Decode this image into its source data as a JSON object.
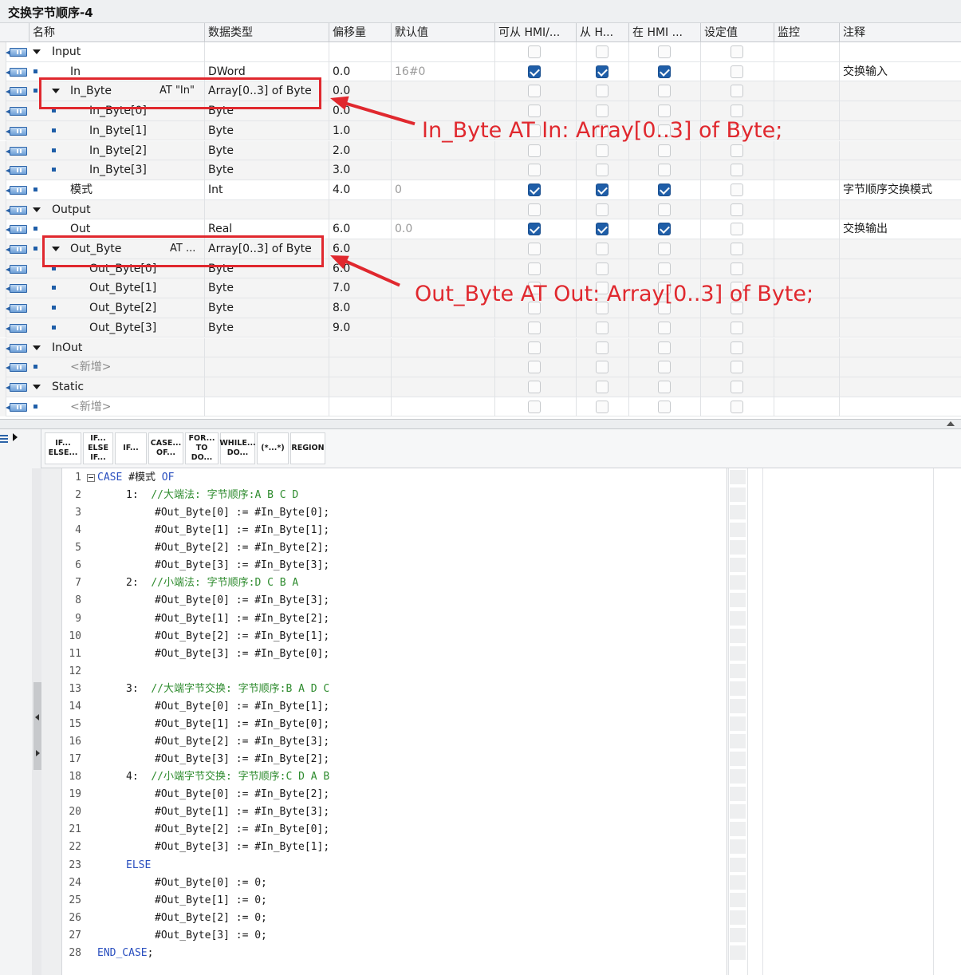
{
  "window": {
    "title": "交换字节顺序-4"
  },
  "columns": [
    "名称",
    "数据类型",
    "偏移量",
    "默认值",
    "可从 HMI/...",
    "从 H...",
    "在 HMI ...",
    "设定值",
    "监控",
    "注释"
  ],
  "rows": [
    {
      "level": 0,
      "kind": "section",
      "name": "Input",
      "expand": true,
      "type": "",
      "offset": "",
      "default": "",
      "checks": [
        false,
        false,
        false,
        false
      ],
      "comment": "",
      "bg": "white"
    },
    {
      "level": 1,
      "kind": "var",
      "name": "In",
      "type": "DWord",
      "offset": "0.0",
      "default": "16#0",
      "checks": [
        true,
        true,
        true,
        false
      ],
      "comment": "交换输入",
      "bg": "white"
    },
    {
      "level": 1,
      "kind": "at",
      "name": "In_Byte",
      "expand": true,
      "at_text": "AT \"In\"",
      "type": "Array[0..3] of Byte",
      "offset": "0.0",
      "default": "",
      "checks": [
        false,
        false,
        false,
        false
      ],
      "comment": "",
      "bg": "grey"
    },
    {
      "level": 2,
      "kind": "elem",
      "name": "In_Byte[0]",
      "type": "Byte",
      "offset": "0.0",
      "default": "",
      "checks": [
        false,
        false,
        false,
        false
      ],
      "comment": "",
      "bg": "grey"
    },
    {
      "level": 2,
      "kind": "elem",
      "name": "In_Byte[1]",
      "type": "Byte",
      "offset": "1.0",
      "default": "",
      "checks": [
        false,
        false,
        false,
        false
      ],
      "comment": "",
      "bg": "grey"
    },
    {
      "level": 2,
      "kind": "elem",
      "name": "In_Byte[2]",
      "type": "Byte",
      "offset": "2.0",
      "default": "",
      "checks": [
        false,
        false,
        false,
        false
      ],
      "comment": "",
      "bg": "grey"
    },
    {
      "level": 2,
      "kind": "elem",
      "name": "In_Byte[3]",
      "type": "Byte",
      "offset": "3.0",
      "default": "",
      "checks": [
        false,
        false,
        false,
        false
      ],
      "comment": "",
      "bg": "grey"
    },
    {
      "level": 1,
      "kind": "var",
      "name": "模式",
      "type": "Int",
      "offset": "4.0",
      "default": "0",
      "checks": [
        true,
        true,
        true,
        false
      ],
      "comment": "字节顺序交换模式",
      "bg": "white"
    },
    {
      "level": 0,
      "kind": "section",
      "name": "Output",
      "expand": true,
      "type": "",
      "offset": "",
      "default": "",
      "checks": [
        false,
        false,
        false,
        false
      ],
      "comment": "",
      "bg": "grey"
    },
    {
      "level": 1,
      "kind": "var",
      "name": "Out",
      "type": "Real",
      "offset": "6.0",
      "default": "0.0",
      "checks": [
        true,
        true,
        true,
        false
      ],
      "comment": "交换输出",
      "bg": "white"
    },
    {
      "level": 1,
      "kind": "at",
      "name": "Out_Byte",
      "expand": true,
      "at_text": "AT ...",
      "type": "Array[0..3] of Byte",
      "offset": "6.0",
      "default": "",
      "checks": [
        false,
        false,
        false,
        false
      ],
      "comment": "",
      "bg": "grey"
    },
    {
      "level": 2,
      "kind": "elem",
      "name": "Out_Byte[0]",
      "type": "Byte",
      "offset": "6.0",
      "default": "",
      "checks": [
        false,
        false,
        false,
        false
      ],
      "comment": "",
      "bg": "grey"
    },
    {
      "level": 2,
      "kind": "elem",
      "name": "Out_Byte[1]",
      "type": "Byte",
      "offset": "7.0",
      "default": "",
      "checks": [
        false,
        false,
        false,
        false
      ],
      "comment": "",
      "bg": "grey"
    },
    {
      "level": 2,
      "kind": "elem",
      "name": "Out_Byte[2]",
      "type": "Byte",
      "offset": "8.0",
      "default": "",
      "checks": [
        false,
        false,
        false,
        false
      ],
      "comment": "",
      "bg": "grey"
    },
    {
      "level": 2,
      "kind": "elem",
      "name": "Out_Byte[3]",
      "type": "Byte",
      "offset": "9.0",
      "default": "",
      "checks": [
        false,
        false,
        false,
        false
      ],
      "comment": "",
      "bg": "grey"
    },
    {
      "level": 0,
      "kind": "section",
      "name": "InOut",
      "expand": true,
      "type": "",
      "offset": "",
      "default": "",
      "checks": [
        false,
        false,
        false,
        false
      ],
      "comment": "",
      "bg": "grey"
    },
    {
      "level": 1,
      "kind": "new",
      "name": "<新增>",
      "type": "",
      "offset": "",
      "default": "",
      "checks": [
        false,
        false,
        false,
        false
      ],
      "comment": "",
      "bg": "grey"
    },
    {
      "level": 0,
      "kind": "section",
      "name": "Static",
      "expand": true,
      "type": "",
      "offset": "",
      "default": "",
      "checks": [
        false,
        false,
        false,
        false
      ],
      "comment": "",
      "bg": "grey"
    },
    {
      "level": 1,
      "kind": "new",
      "name": "<新增>",
      "type": "",
      "offset": "",
      "default": "",
      "checks": [
        false,
        false,
        false,
        false
      ],
      "comment": "",
      "bg": "white"
    }
  ],
  "annotations": {
    "in_label": "In_Byte AT In: Array[0..3] of Byte;",
    "out_label": "Out_Byte AT Out: Array[0..3] of Byte;"
  },
  "toolbar": [
    {
      "line1": "IF...",
      "line2": "ELSE...",
      "line3": ""
    },
    {
      "line1": "IF...",
      "line2": "ELSE",
      "line3": "IF..."
    },
    {
      "line1": "IF...",
      "line2": "",
      "line3": ""
    },
    {
      "line1": "CASE...",
      "line2": "OF...",
      "line3": ""
    },
    {
      "line1": "FOR...",
      "line2": "TO DO...",
      "line3": ""
    },
    {
      "line1": "WHILE...",
      "line2": "DO...",
      "line3": ""
    },
    {
      "line1": "(*...*)",
      "line2": "",
      "line3": ""
    },
    {
      "line1": "REGION",
      "line2": "",
      "line3": ""
    }
  ],
  "code_lines": [
    {
      "n": "1",
      "indent": 0,
      "parts": [
        [
          "kw",
          "CASE"
        ],
        [
          "t",
          " #模式 "
        ],
        [
          "kw",
          "OF"
        ]
      ],
      "fold": true
    },
    {
      "n": "2",
      "indent": 1,
      "parts": [
        [
          "t",
          "1:  "
        ],
        [
          "cm",
          "//大端法: 字节顺序:A B C D"
        ]
      ]
    },
    {
      "n": "3",
      "indent": 2,
      "parts": [
        [
          "t",
          "#Out_Byte[0] := #In_Byte[0];"
        ]
      ]
    },
    {
      "n": "4",
      "indent": 2,
      "parts": [
        [
          "t",
          "#Out_Byte[1] := #In_Byte[1];"
        ]
      ]
    },
    {
      "n": "5",
      "indent": 2,
      "parts": [
        [
          "t",
          "#Out_Byte[2] := #In_Byte[2];"
        ]
      ]
    },
    {
      "n": "6",
      "indent": 2,
      "parts": [
        [
          "t",
          "#Out_Byte[3] := #In_Byte[3];"
        ]
      ]
    },
    {
      "n": "7",
      "indent": 1,
      "parts": [
        [
          "t",
          "2:  "
        ],
        [
          "cm",
          "//小端法: 字节顺序:D C B A"
        ]
      ]
    },
    {
      "n": "8",
      "indent": 2,
      "parts": [
        [
          "t",
          "#Out_Byte[0] := #In_Byte[3];"
        ]
      ]
    },
    {
      "n": "9",
      "indent": 2,
      "parts": [
        [
          "t",
          "#Out_Byte[1] := #In_Byte[2];"
        ]
      ]
    },
    {
      "n": "10",
      "indent": 2,
      "parts": [
        [
          "t",
          "#Out_Byte[2] := #In_Byte[1];"
        ]
      ]
    },
    {
      "n": "11",
      "indent": 2,
      "parts": [
        [
          "t",
          "#Out_Byte[3] := #In_Byte[0];"
        ]
      ]
    },
    {
      "n": "12",
      "indent": 0,
      "parts": []
    },
    {
      "n": "13",
      "indent": 1,
      "parts": [
        [
          "t",
          "3:  "
        ],
        [
          "cm",
          "//大端字节交换: 字节顺序:B A D C"
        ]
      ]
    },
    {
      "n": "14",
      "indent": 2,
      "parts": [
        [
          "t",
          "#Out_Byte[0] := #In_Byte[1];"
        ]
      ]
    },
    {
      "n": "15",
      "indent": 2,
      "parts": [
        [
          "t",
          "#Out_Byte[1] := #In_Byte[0];"
        ]
      ]
    },
    {
      "n": "16",
      "indent": 2,
      "parts": [
        [
          "t",
          "#Out_Byte[2] := #In_Byte[3];"
        ]
      ]
    },
    {
      "n": "17",
      "indent": 2,
      "parts": [
        [
          "t",
          "#Out_Byte[3] := #In_Byte[2];"
        ]
      ]
    },
    {
      "n": "18",
      "indent": 1,
      "parts": [
        [
          "t",
          "4:  "
        ],
        [
          "cm",
          "//小端字节交换: 字节顺序:C D A B"
        ]
      ]
    },
    {
      "n": "19",
      "indent": 2,
      "parts": [
        [
          "t",
          "#Out_Byte[0] := #In_Byte[2];"
        ]
      ]
    },
    {
      "n": "20",
      "indent": 2,
      "parts": [
        [
          "t",
          "#Out_Byte[1] := #In_Byte[3];"
        ]
      ]
    },
    {
      "n": "21",
      "indent": 2,
      "parts": [
        [
          "t",
          "#Out_Byte[2] := #In_Byte[0];"
        ]
      ]
    },
    {
      "n": "22",
      "indent": 2,
      "parts": [
        [
          "t",
          "#Out_Byte[3] := #In_Byte[1];"
        ]
      ]
    },
    {
      "n": "23",
      "indent": 1,
      "parts": [
        [
          "kw",
          "ELSE"
        ]
      ]
    },
    {
      "n": "24",
      "indent": 2,
      "parts": [
        [
          "t",
          "#Out_Byte[0] := 0;"
        ]
      ]
    },
    {
      "n": "25",
      "indent": 2,
      "parts": [
        [
          "t",
          "#Out_Byte[1] := 0;"
        ]
      ]
    },
    {
      "n": "26",
      "indent": 2,
      "parts": [
        [
          "t",
          "#Out_Byte[2] := 0;"
        ]
      ]
    },
    {
      "n": "27",
      "indent": 2,
      "parts": [
        [
          "t",
          "#Out_Byte[3] := 0;"
        ]
      ]
    },
    {
      "n": "28",
      "indent": 0,
      "parts": [
        [
          "kw",
          "END_CASE"
        ],
        [
          "t",
          ";"
        ]
      ]
    }
  ],
  "colors": {
    "accent": "#1f5ea8",
    "annotation": "#e0282e",
    "keyword": "#2a4fbf",
    "comment": "#2e8b2e"
  }
}
